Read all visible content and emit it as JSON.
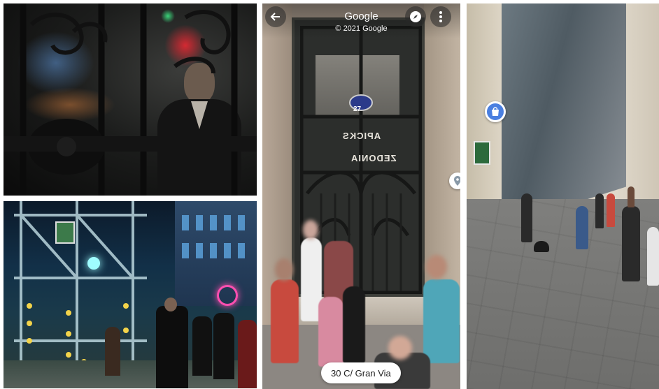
{
  "streetview": {
    "title": "Google",
    "copyright": "© 2021 Google",
    "location_chip": "30 C/ Gran Via",
    "door_number": "27",
    "reflection_text_1": "APICKS",
    "reflection_text_2": "ZEDONIA",
    "icons": {
      "back": "back-arrow-icon",
      "compass": "compass-icon",
      "more": "more-vert-icon",
      "place": "place-pin-icon"
    }
  },
  "street_panel": {
    "icons": {
      "shop": "shopping-bag-icon"
    },
    "pin_color": "#4a7fe0"
  },
  "colors": {
    "chip_bg": "#ffffff",
    "neon_pink": "#ff4fb0",
    "neon_cyan": "#9ffcff"
  }
}
